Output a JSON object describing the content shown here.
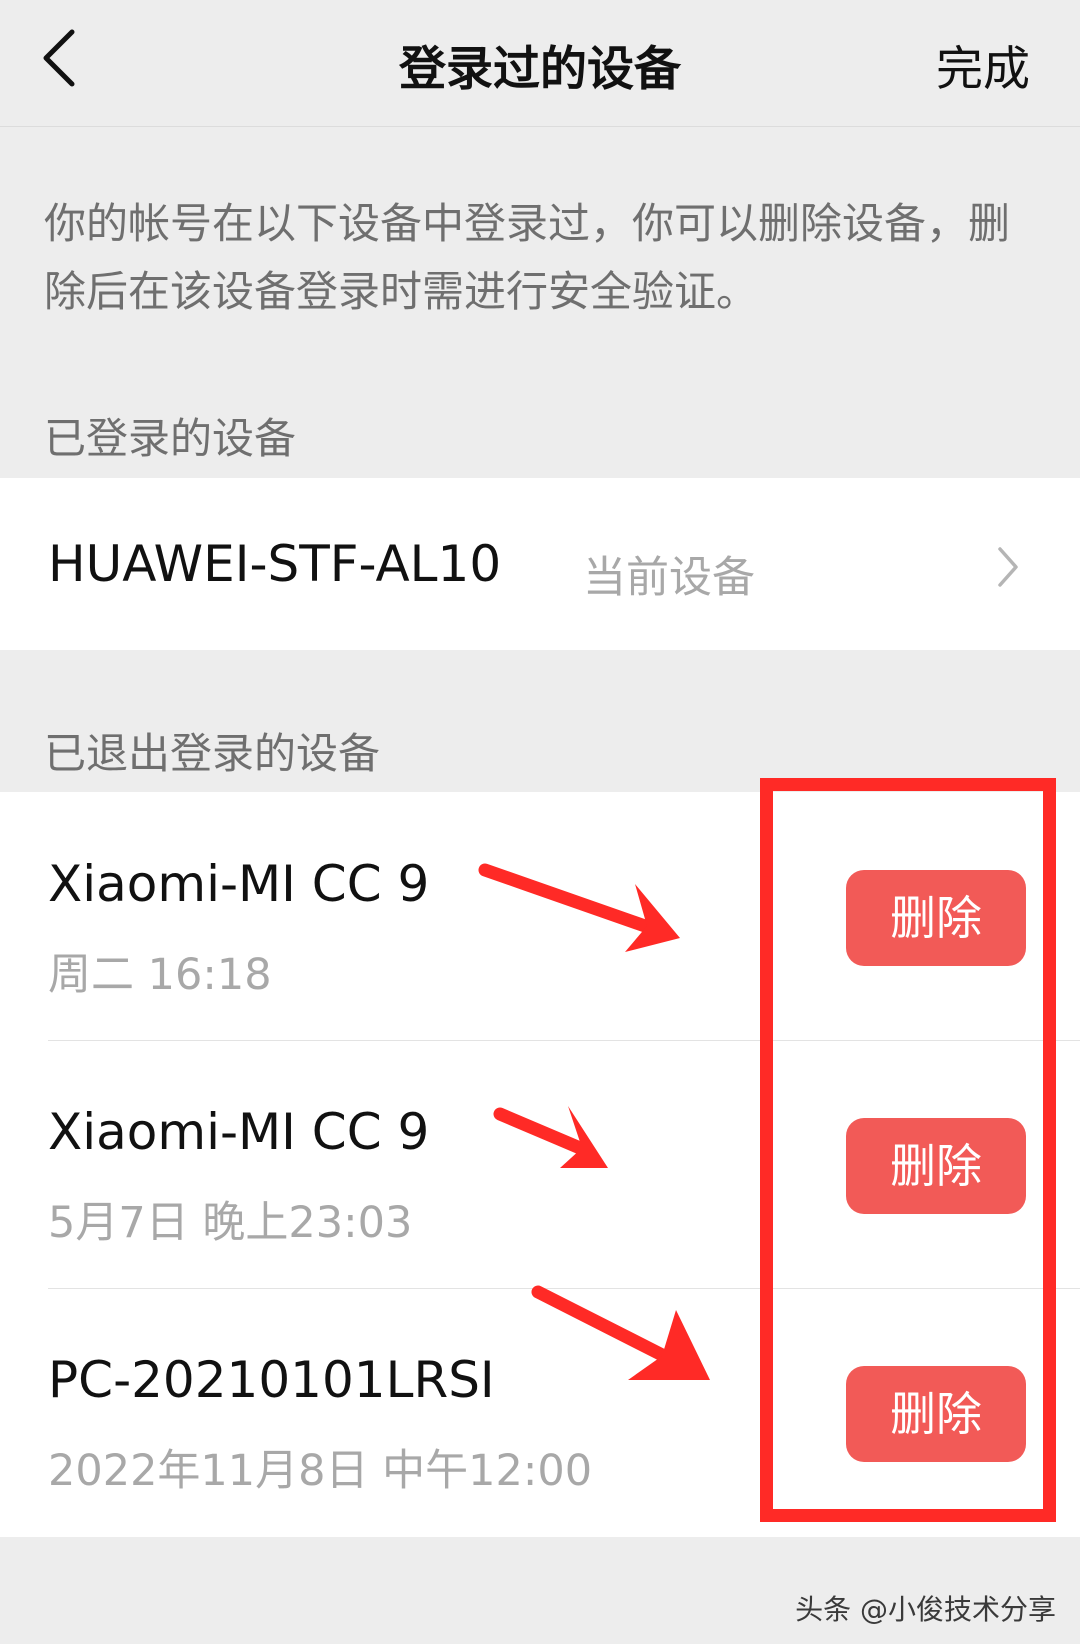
{
  "header": {
    "title": "登录过的设备",
    "done_label": "完成"
  },
  "intro_text": "你的帐号在以下设备中登录过，你可以删除设备，删除后在该设备登录时需进行安全验证。",
  "logged_in_section": {
    "label": "已登录的设备",
    "device": {
      "name": "HUAWEI-STF-AL10",
      "tag": "当前设备"
    }
  },
  "logged_out_section": {
    "label": "已退出登录的设备",
    "devices": [
      {
        "name": "Xiaomi-MI CC 9",
        "time": "周二 16:18",
        "delete_label": "删除"
      },
      {
        "name": "Xiaomi-MI CC 9",
        "time": "5月7日 晚上23:03",
        "delete_label": "删除"
      },
      {
        "name": "PC-20210101LRSI",
        "time": "2022年11月8日 中午12:00",
        "delete_label": "删除"
      }
    ]
  },
  "annotation_color": "#ff2a26",
  "delete_button_color": "#f25a57",
  "watermark": "头条 @小俊技术分享"
}
